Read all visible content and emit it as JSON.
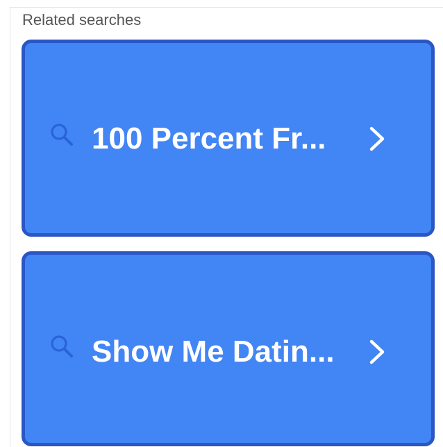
{
  "section": {
    "heading": "Related searches"
  },
  "related_searches": [
    {
      "label": "100 Percent Fr...",
      "icon": "search-icon",
      "trailing_icon": "chevron-right-icon"
    },
    {
      "label": "Show Me Datin...",
      "icon": "search-icon",
      "trailing_icon": "chevron-right-icon"
    }
  ],
  "colors": {
    "card_background": "#4285f4",
    "card_border": "#2a56c6",
    "icon_color": "#2a63d8",
    "label_color": "#ffffff",
    "heading_color": "#555555"
  }
}
